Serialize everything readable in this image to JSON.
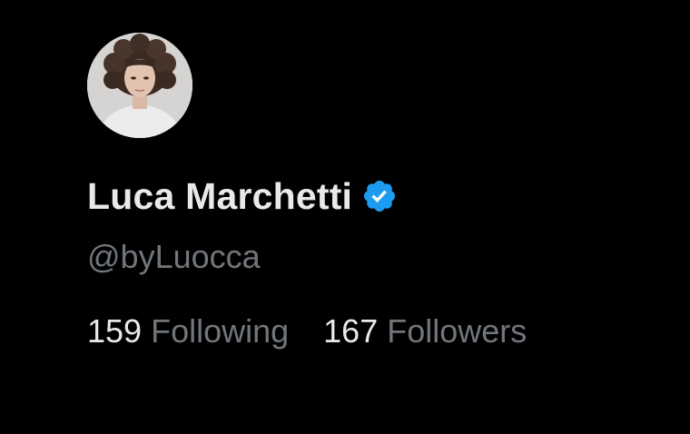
{
  "profile": {
    "display_name": "Luca Marchetti",
    "handle": "@byLuocca",
    "verified": true,
    "avatar_icon": "profile-photo"
  },
  "stats": {
    "following_count": "159",
    "following_label": "Following",
    "followers_count": "167",
    "followers_label": "Followers"
  },
  "colors": {
    "background": "#000000",
    "primary_text": "#e7e9ea",
    "secondary_text": "#71767b",
    "verified_badge": "#1d9bf0"
  }
}
